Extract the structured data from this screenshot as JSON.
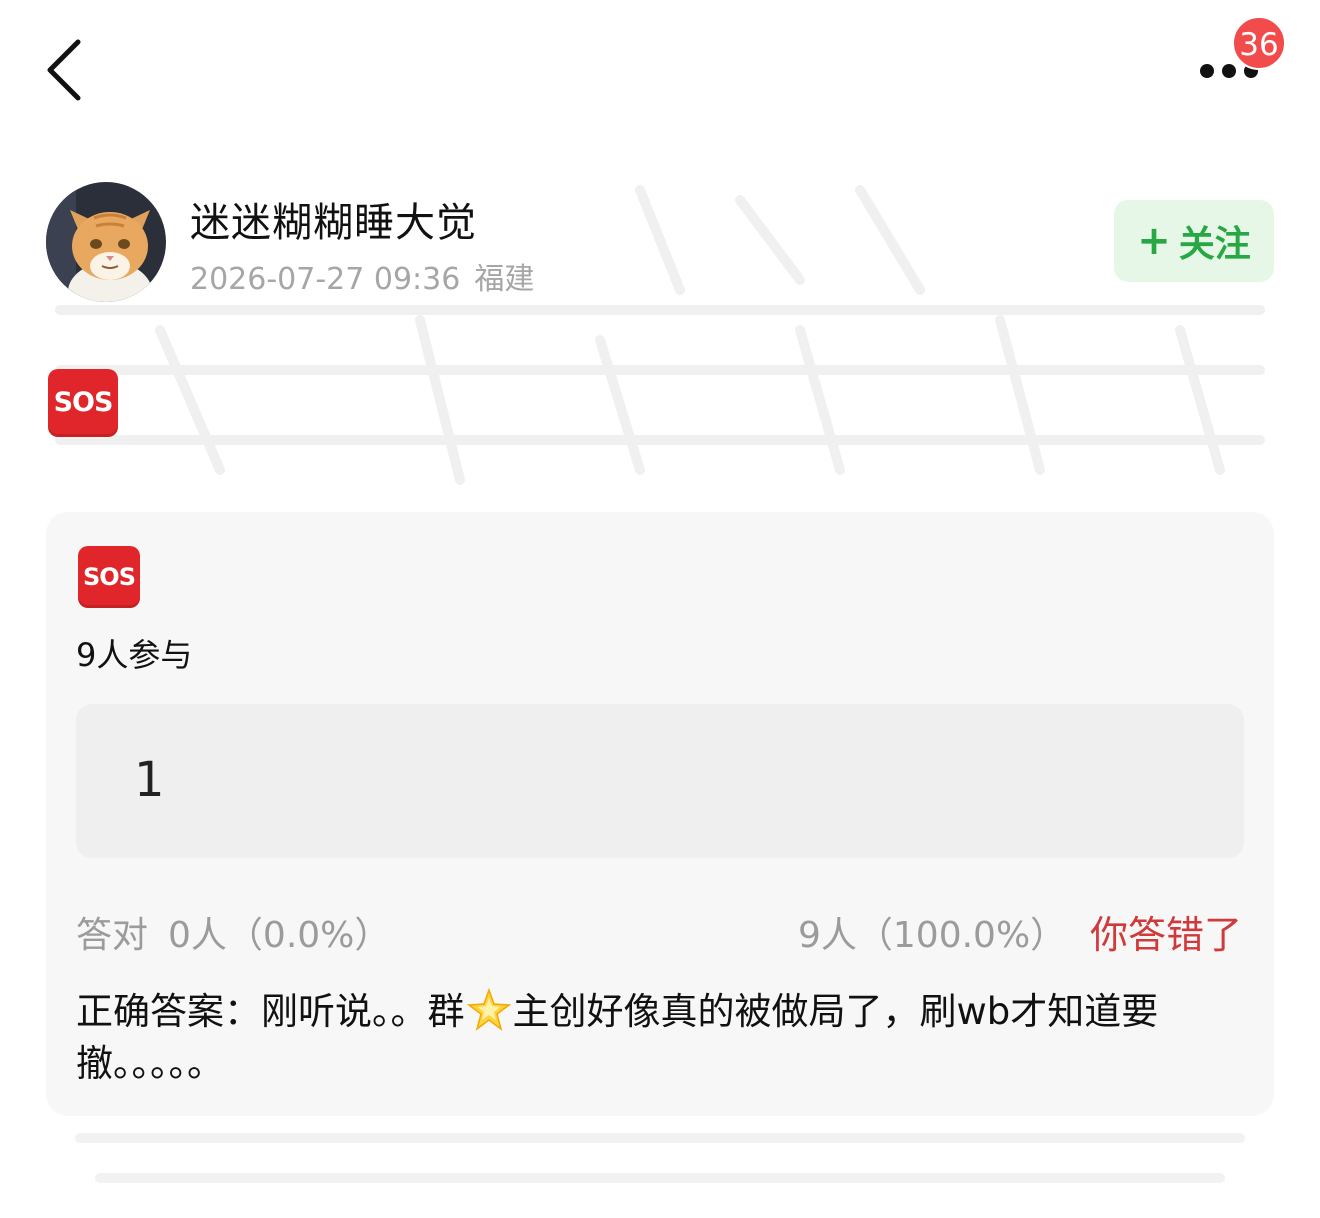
{
  "topbar": {
    "notification_count": "36"
  },
  "post": {
    "author": "迷迷糊糊睡大觉",
    "timestamp": "2026-07-27 09:36",
    "location": "福建",
    "follow_label": "+ 关注",
    "follow_plus": "+",
    "follow_text": "关注",
    "emoji_label": "SOS"
  },
  "quiz": {
    "emoji_label": "SOS",
    "participants": "9人参与",
    "option": "1",
    "correct_label": "答对",
    "correct_stat": "0人（0.0%）",
    "wrong_stat": "9人（100.0%）",
    "result": "你答错了",
    "answer_before": "正确答案：刚听说。。群",
    "answer_after": "主创好像真的被做局了，刷wb才知道要撤。。。。。"
  },
  "colors": {
    "badge": "#f24b4b",
    "follow_bg": "#e6f7e8",
    "follow_text": "#27a844",
    "wrong": "#d03a3a",
    "sos_red": "#e0262a"
  },
  "icons": {
    "back": "chevron-left-icon",
    "more": "more-dots-icon",
    "star": "glowing-star-icon",
    "sos": "sos-icon"
  }
}
